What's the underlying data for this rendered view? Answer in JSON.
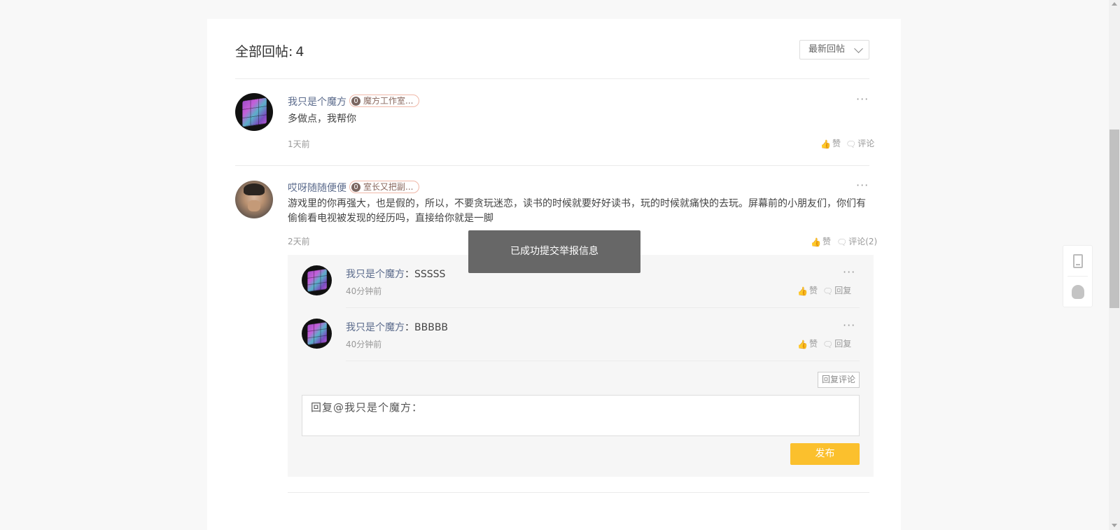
{
  "header": {
    "title": "全部回帖:",
    "count": "4",
    "sort_label": "最新回帖"
  },
  "posts": [
    {
      "username": "我只是个魔方",
      "badge_level": "0",
      "badge_label": "魔方工作室...",
      "content": "多做点，我帮你",
      "time": "1天前",
      "like_label": "赞",
      "comment_label": "评论",
      "more": "···"
    },
    {
      "username": "哎呀随随便便",
      "badge_level": "0",
      "badge_label": "室长又把副...",
      "content": "游戏里的你再强大，也是假的，所以，不要贪玩迷恋，读书的时候就要好好读书，玩的时候就痛快的去玩。屏幕前的小朋友们，你们有偷偷看电视被发现的经历吗，直接给你就是一脚",
      "time": "2天前",
      "like_label": "赞",
      "comment_label": "评论(2)",
      "more": "···"
    }
  ],
  "replies": [
    {
      "username": "我只是个魔方",
      "separator": "：",
      "text": "SSSSS",
      "time": "40分钟前",
      "like_label": "赞",
      "reply_label": "回复",
      "more": "···"
    },
    {
      "username": "我只是个魔方",
      "separator": "：",
      "text": "BBBBB",
      "time": "40分钟前",
      "like_label": "赞",
      "reply_label": "回复",
      "more": "···"
    }
  ],
  "reply_form": {
    "reply_comment_label": "回复评论",
    "input_value": "回复@我只是个魔方：",
    "publish_label": "发布"
  },
  "toast": {
    "message": "已成功提交举报信息"
  },
  "colors": {
    "accent": "#fbc02d",
    "username": "#5b6b8c",
    "toast_bg": "#5a5a5a"
  }
}
